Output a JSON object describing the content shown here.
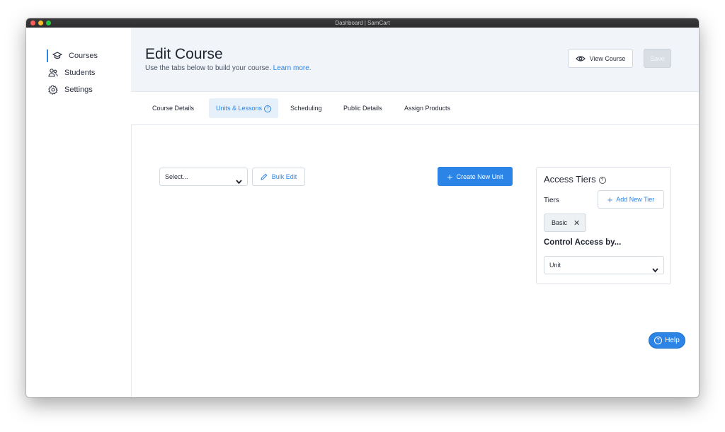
{
  "window": {
    "title": "Dashboard | SamCart"
  },
  "sidebar": {
    "items": [
      {
        "label": "Courses",
        "icon": "graduation-cap-icon",
        "active": true
      },
      {
        "label": "Students",
        "icon": "users-icon",
        "active": false
      },
      {
        "label": "Settings",
        "icon": "gear-icon",
        "active": false
      }
    ]
  },
  "header": {
    "title": "Edit Course",
    "subtitle": "Use the tabs below to build your course.",
    "learn_more": "Learn more.",
    "view_course": "View Course",
    "save": "Save"
  },
  "tabs": [
    {
      "label": "Course Details",
      "active": false
    },
    {
      "label": "Units & Lessons",
      "active": true
    },
    {
      "label": "Scheduling",
      "active": false
    },
    {
      "label": "Public Details",
      "active": false
    },
    {
      "label": "Assign Products",
      "active": false
    }
  ],
  "toolbar": {
    "select_value": "Select...",
    "bulk_edit": "Bulk Edit",
    "create_unit": "Create New Unit"
  },
  "access_tiers": {
    "title": "Access Tiers",
    "tiers_label": "Tiers",
    "add_tier": "Add New Tier",
    "chips": [
      "Basic"
    ],
    "control_label": "Control Access by...",
    "control_value": "Unit"
  },
  "help": {
    "label": "Help"
  },
  "colors": {
    "accent": "#2b84e6",
    "header_bg": "#f1f5f9"
  }
}
